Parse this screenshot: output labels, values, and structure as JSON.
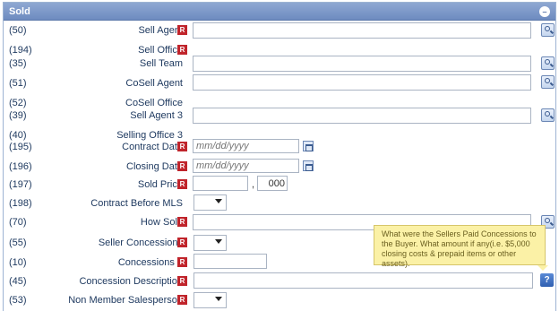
{
  "panel": {
    "title": "Sold",
    "collapse_symbol": "–",
    "required_mark": "R",
    "help_symbol": "?"
  },
  "fields": [
    {
      "num": "(50)",
      "label": "Sell Agent",
      "required": true,
      "control": "text-lookup",
      "value": ""
    },
    {
      "num": "(194)",
      "label": "Sell Office",
      "required": true,
      "control": "none"
    },
    {
      "num": "(35)",
      "label": "Sell Team",
      "required": false,
      "control": "text-lookup",
      "value": ""
    },
    {
      "num": "(51)",
      "label": "CoSell Agent",
      "required": false,
      "control": "text-lookup",
      "value": ""
    },
    {
      "num": "(52)",
      "label": "CoSell Office",
      "required": false,
      "control": "none"
    },
    {
      "num": "(39)",
      "label": "Sell Agent 3",
      "required": false,
      "control": "text-lookup",
      "value": ""
    },
    {
      "num": "(40)",
      "label": "Selling Office 3",
      "required": false,
      "control": "none"
    },
    {
      "num": "(195)",
      "label": "Contract Date",
      "required": true,
      "control": "date",
      "placeholder": "mm/dd/yyyy"
    },
    {
      "num": "(196)",
      "label": "Closing Date",
      "required": true,
      "control": "date",
      "placeholder": "mm/dd/yyyy"
    },
    {
      "num": "(197)",
      "label": "Sold Price",
      "required": true,
      "control": "price",
      "value": "",
      "separator": ",",
      "cents": "000"
    },
    {
      "num": "(198)",
      "label": "Contract Before MLS",
      "required": false,
      "control": "select",
      "value": ""
    },
    {
      "num": "(70)",
      "label": "How Sold",
      "required": true,
      "control": "text-lookup",
      "value": ""
    },
    {
      "num": "(55)",
      "label": "Seller Concessions",
      "required": true,
      "control": "select",
      "value": ""
    },
    {
      "num": "(10)",
      "label": "Concessions $",
      "required": true,
      "control": "short-text",
      "value": ""
    },
    {
      "num": "(45)",
      "label": "Concession Description",
      "required": true,
      "control": "text-help",
      "value": ""
    },
    {
      "num": "(53)",
      "label": "Non Member Salesperson",
      "required": true,
      "control": "select",
      "value": ""
    }
  ],
  "tooltip": {
    "text": "What were the Sellers Paid Concessions to the Buyer. What amount if any(i.e. $5,000 closing costs & prepaid items or other assets)."
  }
}
